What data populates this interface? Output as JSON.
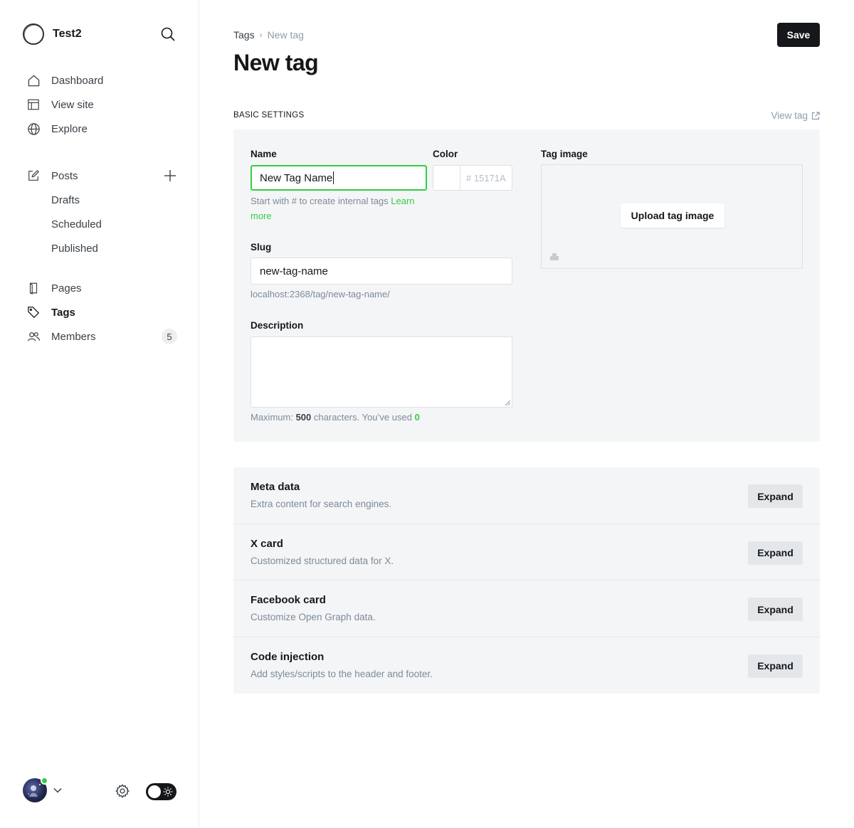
{
  "site": {
    "title": "Test2"
  },
  "nav": {
    "dashboard": "Dashboard",
    "view_site": "View site",
    "explore": "Explore",
    "posts": "Posts",
    "drafts": "Drafts",
    "scheduled": "Scheduled",
    "published": "Published",
    "pages": "Pages",
    "tags": "Tags",
    "members": "Members",
    "members_count": "5"
  },
  "header": {
    "breadcrumb_parent": "Tags",
    "breadcrumb_separator": "›",
    "breadcrumb_current": "New tag",
    "title": "New tag",
    "save_label": "Save"
  },
  "basic_settings": {
    "section_title": "Basic settings",
    "view_tag_label": "View tag",
    "name_label": "Name",
    "name_value": "New Tag Name",
    "name_hint": "Start with # to create internal tags",
    "name_hint_link": "Learn more",
    "color_label": "Color",
    "color_hash": "#",
    "color_placeholder": "15171A",
    "slug_label": "Slug",
    "slug_value": "new-tag-name",
    "slug_url": "localhost:2368/tag/new-tag-name/",
    "description_label": "Description",
    "description_value": "",
    "description_hint_prefix": "Maximum:",
    "description_max": "500",
    "description_hint_mid": "characters. You’ve used",
    "description_used": "0",
    "image_label": "Tag image",
    "upload_label": "Upload tag image"
  },
  "expand_sections": [
    {
      "title": "Meta data",
      "desc": "Extra content for search engines.",
      "button": "Expand"
    },
    {
      "title": "X card",
      "desc": "Customized structured data for X.",
      "button": "Expand"
    },
    {
      "title": "Facebook card",
      "desc": "Customize Open Graph data.",
      "button": "Expand"
    },
    {
      "title": "Code injection",
      "desc": "Add styles/scripts to the header and footer.",
      "button": "Expand"
    }
  ],
  "colors": {
    "accent": "#30cf43",
    "text": "#15171a",
    "panel": "#f4f5f6",
    "muted": "#7c8b9a"
  }
}
